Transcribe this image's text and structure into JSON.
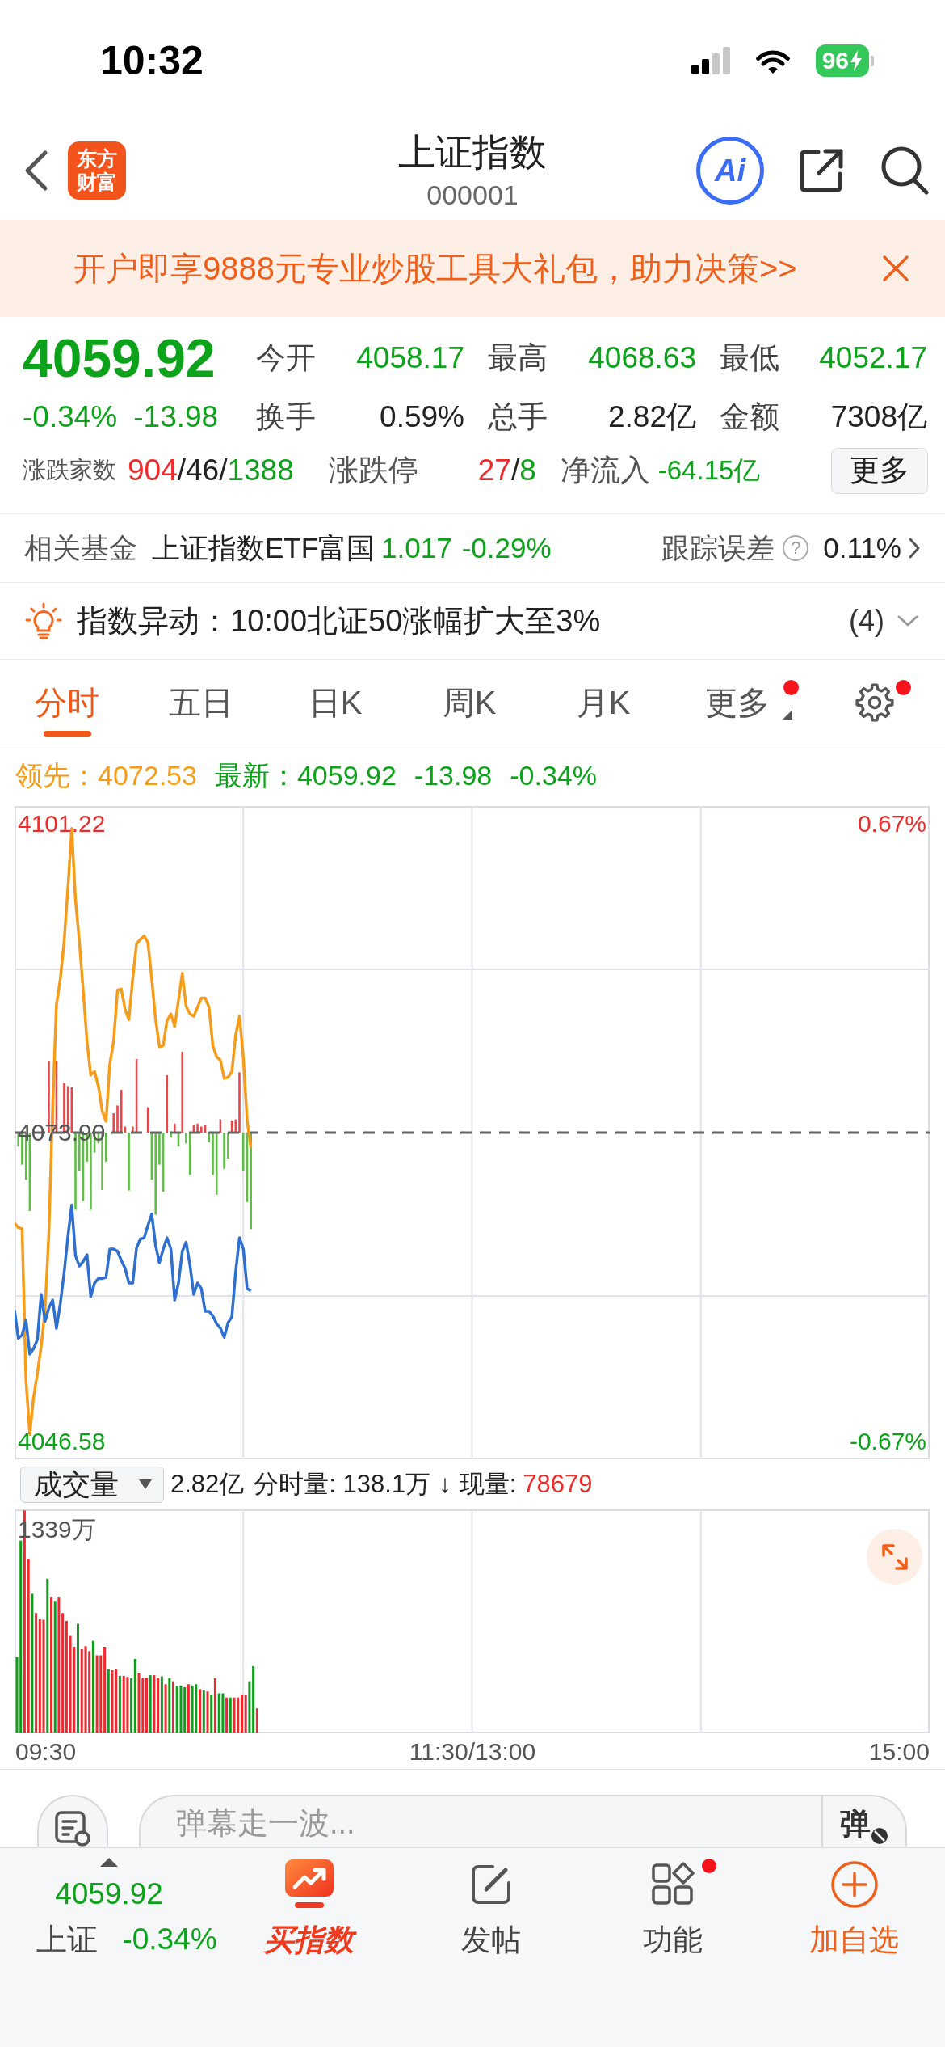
{
  "status_bar": {
    "time": "10:32",
    "battery": "96"
  },
  "header": {
    "logo": "东方财富",
    "title": "上证指数",
    "code": "000001",
    "ai_label": "Ai"
  },
  "banner": {
    "text": "开户即享9888元专业炒股工具大礼包，助力决策>>"
  },
  "quote": {
    "price": "4059.92",
    "color": "#0ca31b",
    "change_percent": "-0.34%",
    "change": "-13.98",
    "stats": [
      {
        "label": "今开",
        "value": "4058.17",
        "color": "#0ca31b"
      },
      {
        "label": "最高",
        "value": "4068.63",
        "color": "#0ca31b"
      },
      {
        "label": "最低",
        "value": "4052.17",
        "color": "#0ca31b"
      },
      {
        "label": "换手",
        "value": "0.59%",
        "color": "#222222"
      },
      {
        "label": "总手",
        "value": "2.82亿",
        "color": "#222222"
      },
      {
        "label": "金额",
        "value": "7308亿",
        "color": "#222222"
      }
    ],
    "breadth": {
      "label": "涨跌家数",
      "parts": [
        {
          "text": "904",
          "color": "#ee2b2b"
        },
        {
          "text": "/46/",
          "color": "#222222"
        },
        {
          "text": "1388",
          "color": "#0ca31b"
        }
      ]
    },
    "limits": {
      "label": "涨跌停",
      "parts": [
        {
          "text": "27",
          "color": "#ee2b2b"
        },
        {
          "text": "/",
          "color": "#222222"
        },
        {
          "text": "8",
          "color": "#0ca31b"
        }
      ]
    },
    "net_inflow": {
      "label": "净流入",
      "value": "-64.15亿",
      "color": "#0ca31b"
    },
    "more_button": "更多"
  },
  "related_fund": {
    "label": "相关基金",
    "name": "上证指数ETF富国",
    "price": "1.017",
    "change": "-0.29%",
    "color": "#0ca31b",
    "tracking_label": "跟踪误差",
    "help": "?",
    "tracking_value": "0.11%"
  },
  "alert": {
    "text": "指数异动：10:00北证50涨幅扩大至3%",
    "count": "(4)",
    "expanded": false
  },
  "tabs": [
    {
      "label": "分时",
      "selected": true,
      "badge": false,
      "menu": false
    },
    {
      "label": "五日",
      "selected": false,
      "badge": false,
      "menu": false
    },
    {
      "label": "日K",
      "selected": false,
      "badge": false,
      "menu": false
    },
    {
      "label": "周K",
      "selected": false,
      "badge": false,
      "menu": false
    },
    {
      "label": "月K",
      "selected": false,
      "badge": false,
      "menu": false
    },
    {
      "label": "更多",
      "selected": false,
      "badge": true,
      "menu": true
    }
  ],
  "settings": {
    "badge": true
  },
  "chart": {
    "legend": [
      {
        "values": [
          "4072.53"
        ],
        "color": "#f59c1a"
      },
      {
        "values": [
          "4059.92",
          "-13.98",
          "-0.34%"
        ],
        "color": "#0ca31b"
      }
    ],
    "chart_data": {
      "type": "line",
      "categories": [
        null,
        null,
        null,
        null,
        null,
        null,
        null,
        null,
        null,
        null,
        null,
        null,
        null,
        null,
        null,
        null,
        null,
        null,
        null,
        null,
        null,
        null,
        null,
        null,
        null,
        null,
        null,
        null,
        null,
        null,
        null,
        null,
        null,
        null,
        null,
        null,
        null,
        null,
        null,
        null,
        null,
        null,
        null,
        null,
        null,
        null,
        null,
        null,
        null,
        null,
        null,
        null,
        null,
        null,
        null,
        null,
        null,
        null,
        null,
        null,
        null,
        null,
        null,
        null,
        null,
        null,
        null,
        null,
        null,
        null,
        null,
        null,
        null,
        null,
        null,
        null,
        null,
        null,
        null,
        null,
        null,
        null,
        null,
        null,
        null,
        null,
        null,
        null,
        null,
        null,
        null,
        null,
        null,
        null,
        null,
        null,
        null,
        null,
        null,
        null,
        null,
        null,
        null,
        null,
        null,
        null,
        null,
        null,
        null,
        null,
        null,
        null,
        null,
        null,
        null,
        null,
        null,
        null,
        null,
        null,
        null,
        null,
        null,
        null,
        null,
        null,
        null,
        null,
        null,
        null,
        null,
        null,
        null,
        null,
        null,
        null,
        null,
        null,
        null,
        null,
        null,
        null,
        null,
        null,
        null,
        null,
        null,
        null,
        null,
        null,
        null,
        null,
        null,
        null,
        null,
        null,
        null,
        null,
        null,
        null,
        null,
        null,
        null,
        null,
        null,
        null,
        null,
        null,
        null,
        null,
        null,
        null,
        null,
        null,
        null,
        null,
        null,
        null,
        null,
        null,
        null,
        null,
        null,
        null,
        null,
        null,
        null,
        null,
        null,
        null,
        null,
        null,
        null,
        null,
        null,
        null,
        null,
        null,
        null,
        null,
        null,
        null,
        null,
        null,
        null,
        null,
        null,
        null,
        null,
        null,
        null,
        null,
        null,
        null,
        null,
        null,
        null,
        null,
        null,
        null,
        null,
        null,
        null,
        null,
        null,
        null,
        null,
        null,
        null,
        null,
        null,
        null,
        null,
        null,
        null,
        null,
        null,
        null,
        null,
        null,
        null
      ],
      "ylim": [
        4045.01,
        4102.79
      ],
      "yticks": [
        {
          "value": 4101.22,
          "label": "4101.22"
        },
        {
          "value": 4073.9,
          "label": "4073.90"
        },
        {
          "value": 4046.58,
          "label": "4046.58"
        }
      ],
      "ref_lines": [
        {
          "axis": "y",
          "value": 4073.9
        }
      ],
      "series": [
        {
          "name": "领先：",
          "color": "#f59c1a",
          "values": [
            4065.9,
            4065.5,
            4065.4,
            4052.0,
            4047.2,
            4050.5,
            4052.6,
            4055.0,
            4058.2,
            4065.0,
            4076.0,
            4085.2,
            4087.5,
            4090.8,
            4095.5,
            4100.8,
            4094.5,
            4090.8,
            4086.5,
            4082.0,
            4079.0,
            4079.3,
            4078.0,
            4075.8,
            4074.9,
            4080.0,
            4082.0,
            4086.5,
            4086.6,
            4084.8,
            4083.9,
            4087.5,
            4090.6,
            4091.0,
            4091.3,
            4090.7,
            4087.5,
            4083.9,
            4081.5,
            4081.6,
            4083.8,
            4084.4,
            4083.3,
            4085.6,
            4088.0,
            4085.1,
            4084.4,
            4084.2,
            4085.0,
            4085.8,
            4085.8,
            4085.0,
            4081.6,
            4080.6,
            4080.3,
            4078.7,
            4078.8,
            4079.3,
            4082.5,
            4084.2,
            4080.5,
            4075.0,
            4072.53,
            null,
            null,
            null,
            null,
            null,
            null,
            null,
            null,
            null,
            null,
            null,
            null,
            null,
            null,
            null,
            null,
            null,
            null,
            null,
            null,
            null,
            null,
            null,
            null,
            null,
            null,
            null,
            null,
            null,
            null,
            null,
            null,
            null,
            null,
            null,
            null,
            null,
            null,
            null,
            null,
            null,
            null,
            null,
            null,
            null,
            null,
            null,
            null,
            null,
            null,
            null,
            null,
            null,
            null,
            null,
            null,
            null,
            null,
            null,
            null,
            null,
            null,
            null,
            null,
            null,
            null,
            null,
            null,
            null,
            null,
            null,
            null,
            null,
            null,
            null,
            null,
            null,
            null,
            null,
            null,
            null,
            null,
            null,
            null,
            null,
            null,
            null,
            null,
            null,
            null,
            null,
            null,
            null,
            null,
            null,
            null,
            null,
            null,
            null,
            null,
            null,
            null,
            null,
            null,
            null,
            null,
            null,
            null,
            null,
            null,
            null,
            null,
            null,
            null,
            null,
            null,
            null,
            null,
            null,
            null,
            null,
            null,
            null,
            null,
            null,
            null,
            null,
            null,
            null,
            null,
            null,
            null,
            null,
            null,
            null,
            null,
            null,
            null,
            null,
            null,
            null,
            null,
            null,
            null,
            null,
            null,
            null,
            null,
            null,
            null,
            null,
            null,
            null,
            null,
            null,
            null,
            null,
            null,
            null,
            null,
            null,
            null,
            null,
            null,
            null,
            null,
            null,
            null,
            null,
            null,
            null,
            null,
            null,
            null,
            null,
            null,
            null,
            null
          ]
        },
        {
          "name": "最新：",
          "color": "#2f6fcf",
          "values": [
            4058.2,
            4055.7,
            4056.0,
            4057.3,
            4054.3,
            4054.8,
            4055.6,
            4059.6,
            4057.2,
            4058.4,
            4059.1,
            4056.6,
            4058.8,
            4061.5,
            4064.7,
            4067.5,
            4063.0,
            4062.1,
            4062.5,
            4063.1,
            4059.4,
            4060.6,
            4061.0,
            4061.0,
            4061.1,
            4063.6,
            4063.6,
            4063.4,
            4062.6,
            4061.9,
            4060.6,
            4060.6,
            4063.7,
            4064.5,
            4064.6,
            4065.7,
            4066.7,
            4063.9,
            4062.4,
            4063.6,
            4064.6,
            4063.6,
            4059.1,
            4060.6,
            4063.4,
            4064.2,
            4062.2,
            4059.6,
            4060.6,
            4060.1,
            4058.1,
            4058.1,
            4057.7,
            4057.0,
            4056.6,
            4055.8,
            4057.1,
            4057.6,
            4061.6,
            4064.6,
            4063.6,
            4060.1,
            4059.92,
            null,
            null,
            null,
            null,
            null,
            null,
            null,
            null,
            null,
            null,
            null,
            null,
            null,
            null,
            null,
            null,
            null,
            null,
            null,
            null,
            null,
            null,
            null,
            null,
            null,
            null,
            null,
            null,
            null,
            null,
            null,
            null,
            null,
            null,
            null,
            null,
            null,
            null,
            null,
            null,
            null,
            null,
            null,
            null,
            null,
            null,
            null,
            null,
            null,
            null,
            null,
            null,
            null,
            null,
            null,
            null,
            null,
            null,
            null,
            null,
            null,
            null,
            null,
            null,
            null,
            null,
            null,
            null,
            null,
            null,
            null,
            null,
            null,
            null,
            null,
            null,
            null,
            null,
            null,
            null,
            null,
            null,
            null,
            null,
            null,
            null,
            null,
            null,
            null,
            null,
            null,
            null,
            null,
            null,
            null,
            null,
            null,
            null,
            null,
            null,
            null,
            null,
            null,
            null,
            null,
            null,
            null,
            null,
            null,
            null,
            null,
            null,
            null,
            null,
            null,
            null,
            null,
            null,
            null,
            null,
            null,
            null,
            null,
            null,
            null,
            null,
            null,
            null,
            null,
            null,
            null,
            null,
            null,
            null,
            null,
            null,
            null,
            null,
            null,
            null,
            null,
            null,
            null,
            null,
            null,
            null,
            null,
            null,
            null,
            null,
            null,
            null,
            null,
            null,
            null,
            null,
            null,
            null,
            null,
            null,
            null,
            null,
            null,
            null,
            null,
            null,
            null,
            null,
            null,
            null,
            null,
            null,
            null,
            null,
            null,
            null,
            null,
            null
          ]
        }
      ]
    },
    "right_axis": [
      {
        "label": "0.67%",
        "color": "#ee2b2b"
      },
      {
        "label": "-0.67%",
        "color": "#0ca31b"
      }
    ]
  },
  "volume": {
    "selector": "成交量",
    "total": "2.82亿",
    "minute_volume": "分时量: 138.1万",
    "trend": "↓",
    "current_label": "现量:",
    "current_value": "78679",
    "max_label": "1339万",
    "time_axis": [
      "09:30",
      "11:30/13:00",
      "15:00"
    ]
  },
  "danmaku": {
    "placeholder": "弹幕走一波...",
    "toggle_label": "弹"
  },
  "bottom_bar": {
    "quote": {
      "price": "4059.92",
      "name": "上证",
      "change": "-0.34%",
      "color": "#0ca31b"
    },
    "items": [
      {
        "kind": "buy",
        "label": "买指数",
        "badge": false
      },
      {
        "kind": "post",
        "label": "发帖",
        "badge": false
      },
      {
        "kind": "functions",
        "label": "功能",
        "badge": true
      },
      {
        "kind": "watchlist",
        "label": "加自选",
        "badge": false
      }
    ]
  }
}
